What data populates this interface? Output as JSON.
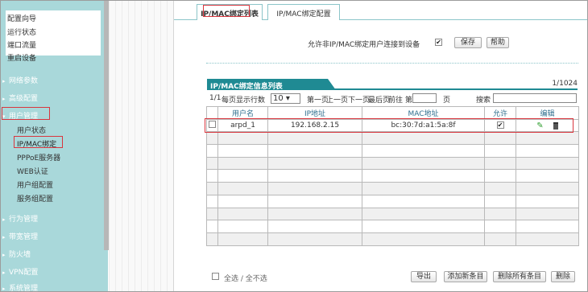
{
  "sidebar": {
    "top_items": [
      "配置向导",
      "运行状态",
      "端口流量",
      "重启设备"
    ],
    "sections": [
      {
        "label": "网络参数",
        "open": false
      },
      {
        "label": "高级配置",
        "open": false
      },
      {
        "label": "用户管理",
        "open": true
      },
      {
        "label": "行为管理",
        "open": false
      },
      {
        "label": "带宽管理",
        "open": false
      },
      {
        "label": "防火墙",
        "open": false
      },
      {
        "label": "VPN配置",
        "open": false
      },
      {
        "label": "系统管理",
        "open": false
      }
    ],
    "user_mgmt_items": [
      "用户状态",
      "IP/MAC绑定",
      "PPPoE服务器",
      "WEB认证",
      "用户组配置",
      "服务组配置"
    ],
    "active_item": "IP/MAC绑定"
  },
  "tabs": [
    "IP/MAC绑定列表",
    "IP/MAC绑定配置"
  ],
  "allow_option": {
    "label": "允许非IP/MAC绑定用户连接到设备",
    "checked": true
  },
  "buttons": {
    "save": "保存",
    "help": "帮助",
    "export": "导出",
    "add": "添加新条目",
    "delete_all": "删除所有条目",
    "delete": "删除"
  },
  "table_title": "IP/MAC绑定信息列表",
  "count": "1/1024",
  "pager": {
    "page": "1/1",
    "per_page_label": "每页显示行数",
    "per_page": "10",
    "first": "第一页",
    "prev": "上一页",
    "next": "下一页",
    "last": "最后页",
    "goto": "前往 第",
    "page_unit": "页",
    "search": "搜索"
  },
  "columns": [
    "用户名",
    "IP地址",
    "MAC地址",
    "允许",
    "编辑"
  ],
  "rows": [
    {
      "name": "arpd_1",
      "ip": "192.168.2.15",
      "mac": "bc:30:7d:a1:5a:8f",
      "allow": true
    }
  ],
  "select_all": "全选 / 全不选"
}
